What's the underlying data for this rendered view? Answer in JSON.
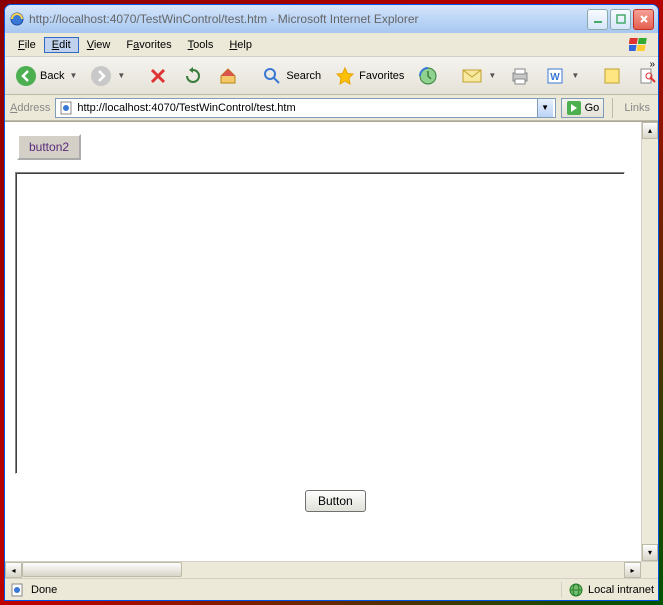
{
  "window": {
    "title": "http://localhost:4070/TestWinControl/test.htm - Microsoft Internet Explorer"
  },
  "menu": {
    "file": "File",
    "edit": "Edit",
    "view": "View",
    "favorites": "Favorites",
    "tools": "Tools",
    "help": "Help"
  },
  "toolbar": {
    "back": "Back",
    "search": "Search",
    "favorites": "Favorites"
  },
  "addressbar": {
    "label": "Address",
    "url": "http://localhost:4070/TestWinControl/test.htm",
    "go": "Go",
    "links": "Links"
  },
  "page": {
    "button2": "button2",
    "center_button": "Button"
  },
  "status": {
    "text": "Done",
    "zone": "Local intranet"
  }
}
